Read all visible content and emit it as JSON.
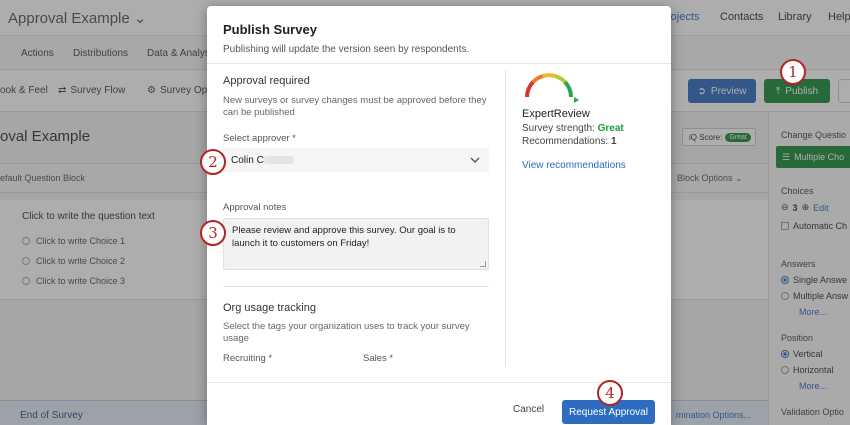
{
  "app": {
    "title": "Approval Example",
    "topnav": [
      "rojects",
      "Contacts",
      "Library",
      "Help"
    ]
  },
  "subnav": [
    "Actions",
    "Distributions",
    "Data & Analysi"
  ],
  "toolbar": {
    "items": [
      "ook & Feel",
      "Survey Flow",
      "Survey Op"
    ],
    "preview_label": "Preview",
    "publish_label": "Publish"
  },
  "survey": {
    "title": "oval Example",
    "iq_label": "iQ Score:",
    "iq_value": "Great",
    "block_name": "efault Question Block",
    "block_options": "Block Options",
    "question_text": "Click to write the question text",
    "choices": [
      "Click to write Choice 1",
      "Click to write Choice 2",
      "Click to write Choice 3"
    ],
    "end_block": "End of Survey",
    "end_block_right": "mination Options..."
  },
  "right_pane": {
    "change_question": "Change Questio",
    "question_type": "Multiple Cho",
    "choices_label": "Choices",
    "choices_count": "3",
    "edit_label": "Edit",
    "automatic_label": "Automatic Ch",
    "answers_label": "Answers",
    "single_answer": "Single Answe",
    "multiple_answer": "Multiple Answ",
    "more1": "More...",
    "position_label": "Position",
    "vertical": "Vertical",
    "horizontal": "Horizontal",
    "more2": "More...",
    "validation_label": "Validation Optio"
  },
  "modal": {
    "title": "Publish Survey",
    "subtitle": "Publishing will update the version seen by respondents.",
    "approval_heading": "Approval required",
    "approval_desc": "New surveys or survey changes must be approved before they can be published",
    "approver_label": "Select approver *",
    "approver_value": "Colin C",
    "notes_label": "Approval notes",
    "notes_value": "Please review and approve this survey. Our goal is to launch it to customers on Friday!",
    "org_heading": "Org usage tracking",
    "org_desc": "Select the tags your organization uses to track your survey usage",
    "tag1": "Recruiting *",
    "tag2": "Sales *",
    "expert_title": "ExpertReview",
    "strength_label": "Survey strength:",
    "strength_value": "Great",
    "recs_label": "Recommendations:",
    "recs_value": "1",
    "view_recs": "View recommendations",
    "cancel_label": "Cancel",
    "request_label": "Request Approval"
  },
  "steps": [
    "1",
    "2",
    "3",
    "4"
  ],
  "colors": {
    "primary_blue": "#2d6cc0",
    "publish_green": "#1b8a3a",
    "callout_red": "#b32424"
  }
}
